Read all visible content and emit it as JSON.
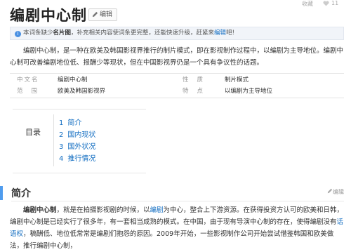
{
  "header": {
    "title": "编剧中心制",
    "edit_label": "编辑",
    "top_right": [
      "收藏",
      "11"
    ]
  },
  "notice": {
    "prefix": "本词条缺少",
    "bold": "名片图",
    "middle": "，补充相关内容使词条更完整，还能快速升级，赶紧来",
    "link": "编辑",
    "suffix": "吧!"
  },
  "intro": {
    "text": "编剧中心制，是一种在欧美及韩国影视界推行的制片模式，即在影视制作过程中，以编剧为主导地位。编剧中心制可改善编剧地位低、报酬少等现状，但在中国影视界仍是一个具有争议性的话题。"
  },
  "info": {
    "rows": [
      {
        "k1": "中文名",
        "v1": "编剧中心制",
        "k2": "性质",
        "v2": "制片模式"
      },
      {
        "k1": "范围",
        "v1": "欧美及韩国影视界",
        "k2": "特点",
        "v2": "以编剧为主导地位"
      }
    ]
  },
  "toc": {
    "heading": "目录",
    "items": [
      {
        "num": "1",
        "label": "简介"
      },
      {
        "num": "2",
        "label": "国内现状"
      },
      {
        "num": "3",
        "label": "国外状况"
      },
      {
        "num": "4",
        "label": "推行情况"
      }
    ]
  },
  "section": {
    "title": "简介",
    "edit_label": "编辑",
    "lead_bold": "编剧中心制",
    "p1": "，就是在拍摄影视剧的时候，以",
    "link1": "编剧",
    "p2": "为中心，整合上下游资源。在获得投资方认可的欧美和日韩，编剧中心制是已经实行了很多年，有一套相当成熟的模式。在中国，由于现有导演中心制的存在，使得编剧没有",
    "link2": "话语权",
    "p3": "，稿酬低、地位低常常是编剧们抱怨的原因。2009年开始，一些影视制作公司开始尝试借鉴韩国和欧美做法，推行编剧中心制，"
  }
}
